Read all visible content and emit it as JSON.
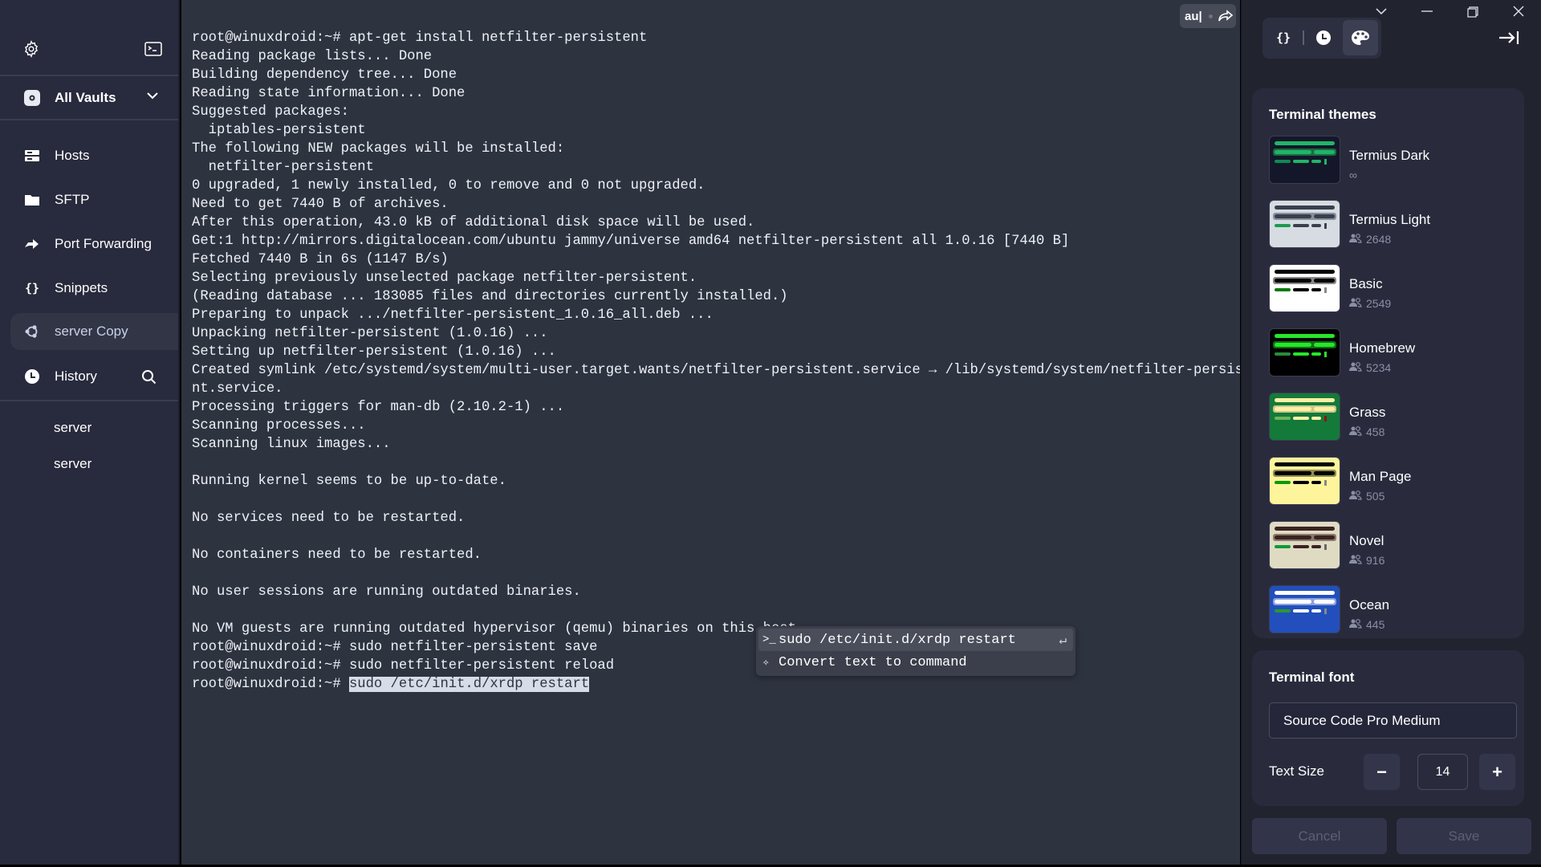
{
  "sidebar": {
    "vault_label": "All Vaults",
    "nav": [
      {
        "label": "Hosts",
        "icon": "hosts-icon"
      },
      {
        "label": "SFTP",
        "icon": "folder-icon"
      },
      {
        "label": "Port Forwarding",
        "icon": "port-forwarding-icon"
      },
      {
        "label": "Snippets",
        "icon": "snippets-icon"
      },
      {
        "label": "server Copy",
        "icon": "ubuntu-icon",
        "active": true
      }
    ],
    "history_label": "History",
    "history_items": [
      "server",
      "server"
    ]
  },
  "terminal": {
    "autocomplete_badge": "au|",
    "lines": [
      "root@winuxdroid:~# apt-get install netfilter-persistent",
      "Reading package lists... Done",
      "Building dependency tree... Done",
      "Reading state information... Done",
      "Suggested packages:",
      "  iptables-persistent",
      "The following NEW packages will be installed:",
      "  netfilter-persistent",
      "0 upgraded, 1 newly installed, 0 to remove and 0 not upgraded.",
      "Need to get 7440 B of archives.",
      "After this operation, 43.0 kB of additional disk space will be used.",
      "Get:1 http://mirrors.digitalocean.com/ubuntu jammy/universe amd64 netfilter-persistent all 1.0.16 [7440 B]",
      "Fetched 7440 B in 6s (1147 B/s)",
      "Selecting previously unselected package netfilter-persistent.",
      "(Reading database ... 183085 files and directories currently installed.)",
      "Preparing to unpack .../netfilter-persistent_1.0.16_all.deb ...",
      "Unpacking netfilter-persistent (1.0.16) ...",
      "Setting up netfilter-persistent (1.0.16) ...",
      "Created symlink /etc/systemd/system/multi-user.target.wants/netfilter-persistent.service → /lib/systemd/system/netfilter-persiste",
      "nt.service.",
      "Processing triggers for man-db (2.10.2-1) ...",
      "Scanning processes...",
      "Scanning linux images...",
      "",
      "Running kernel seems to be up-to-date.",
      "",
      "No services need to be restarted.",
      "",
      "No containers need to be restarted.",
      "",
      "No user sessions are running outdated binaries.",
      "",
      "No VM guests are running outdated hypervisor (qemu) binaries on this host.",
      "root@winuxdroid:~# sudo netfilter-persistent save",
      "root@winuxdroid:~# sudo netfilter-persistent reload"
    ],
    "prompt": "root@winuxdroid:~# ",
    "current_input": "sudo /etc/init.d/xrdp restart",
    "suggestions": [
      {
        "label": "sudo /etc/init.d/xrdp restart",
        "icon": "terminal-prompt-icon"
      },
      {
        "label": "Convert text to command",
        "icon": "sparkle-icon"
      }
    ]
  },
  "panel": {
    "themes_title": "Terminal themes",
    "themes": [
      {
        "name": "Termius Dark",
        "users": "∞",
        "colors": {
          "bg": "#141729",
          "fg": "#21b568",
          "row": "#1a6b42",
          "g": "#0f8a55",
          "cur": "#21b568"
        }
      },
      {
        "name": "Termius Light",
        "users": "2648",
        "colors": {
          "bg": "#d7dce2",
          "fg": "#3a3f4f",
          "row": "#8a8f9c",
          "g": "#1f9a4f",
          "cur": "#3a3f4f"
        }
      },
      {
        "name": "Basic",
        "users": "2549",
        "colors": {
          "bg": "#ffffff",
          "fg": "#000000",
          "row": "#888888",
          "g": "#0a7a0a",
          "cur": "#888888"
        }
      },
      {
        "name": "Homebrew",
        "users": "5234",
        "colors": {
          "bg": "#000000",
          "fg": "#27e62a",
          "row": "#0e6e0e",
          "g": "#2c8a3a",
          "cur": "#27e62a"
        }
      },
      {
        "name": "Grass",
        "users": "458",
        "colors": {
          "bg": "#137a3a",
          "fg": "#fff0a5",
          "row": "#c9c88a",
          "g": "#6fb55a",
          "cur": "#8b1a0a"
        }
      },
      {
        "name": "Man Page",
        "users": "505",
        "colors": {
          "bg": "#fef49c",
          "fg": "#000000",
          "row": "#8f8a55",
          "g": "#0a9a0a",
          "cur": "#888888"
        }
      },
      {
        "name": "Novel",
        "users": "916",
        "colors": {
          "bg": "#dfdbc3",
          "fg": "#3b2322",
          "row": "#8a7a6c",
          "g": "#0a9a3a",
          "cur": "#666666"
        }
      },
      {
        "name": "Ocean",
        "users": "445",
        "colors": {
          "bg": "#224fbc",
          "fg": "#ffffff",
          "row": "#8aa2dc",
          "g": "#2a9a2a",
          "cur": "#888888"
        }
      }
    ],
    "font_title": "Terminal font",
    "font_value": "Source Code Pro Medium",
    "text_size_label": "Text Size",
    "text_size_value": "14",
    "minus_label": "−",
    "plus_label": "+",
    "cancel_label": "Cancel",
    "save_label": "Save"
  }
}
